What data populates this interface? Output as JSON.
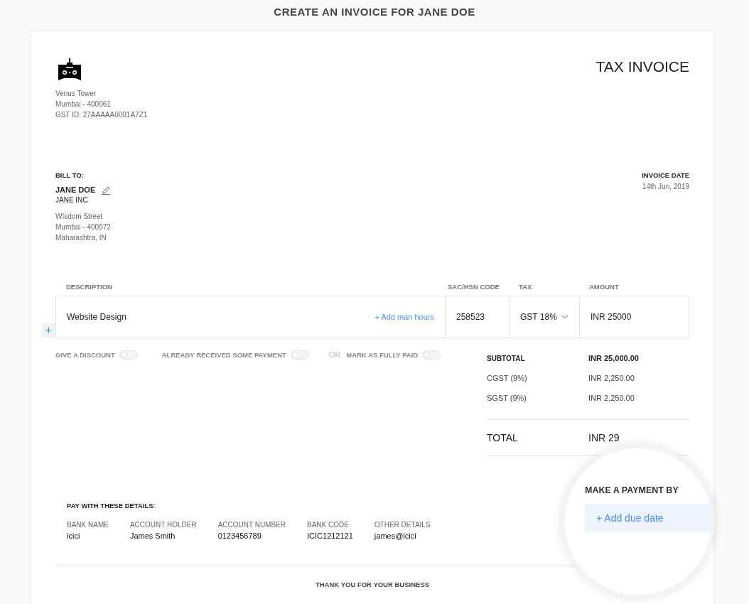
{
  "page_title": "CREATE AN INVOICE FOR JANE DOE",
  "seller": {
    "address_lines": [
      "Venus Tower",
      "Mumbai - 400061",
      "GST ID: 27AAAAA0001A7Z1"
    ]
  },
  "document_title": "TAX INVOICE",
  "bill_to": {
    "label": "BILL TO:",
    "name": "JANE DOE",
    "company": "JANE INC",
    "address_lines": [
      "WIsdom Street",
      "Mumbai - 400072",
      "Maharashtra, IN"
    ]
  },
  "invoice_date": {
    "label": "INVOICE DATE",
    "value": "14th Jun, 2019"
  },
  "items": {
    "columns": [
      "DESCRIPTION",
      "SAC/HSN CODE",
      "TAX",
      "AMOUNT"
    ],
    "rows": [
      {
        "description": "Website Design",
        "add_hours": "+ Add man hours",
        "code": "258523",
        "tax": "GST 18%",
        "amount": "INR  25000"
      }
    ],
    "add_row": "+"
  },
  "toggles": [
    {
      "label": "GIVE A DISCOUNT",
      "on": false
    },
    {
      "label": "ALREADY RECEIVED SOME PAYMENT",
      "on": false
    },
    {
      "label": "MARK AS FULLY PAID",
      "on": false
    }
  ],
  "or_separator": "OR",
  "totals": [
    {
      "kind": "subtotal",
      "label": "SUBTOTAL",
      "value": "INR 25,000.00"
    },
    {
      "kind": "tax",
      "label": "CGST (9%)",
      "value": "INR 2,250.00"
    },
    {
      "kind": "tax",
      "label": "SGST (9%)",
      "value": "INR 2,250.00"
    },
    {
      "kind": "total",
      "label": "TOTAL",
      "value": "INR 29"
    }
  ],
  "payment_details": {
    "title": "PAY WITH THESE DETAILS:",
    "fields": [
      {
        "label": "BANK NAME",
        "value": "icici"
      },
      {
        "label": "ACCOUNT HOLDER",
        "value": "James Smith"
      },
      {
        "label": "ACCOUNT NUMBER",
        "value": "0123456789"
      },
      {
        "label": "BANK CODE",
        "value": "ICIC1212121"
      },
      {
        "label": "OTHER DETAILS",
        "value": "james@icici"
      }
    ]
  },
  "make_payment": {
    "title": "MAKE A PAYMENT BY",
    "button": "+ Add due date"
  },
  "footer": "THANK YOU FOR YOUR BUSINESS"
}
